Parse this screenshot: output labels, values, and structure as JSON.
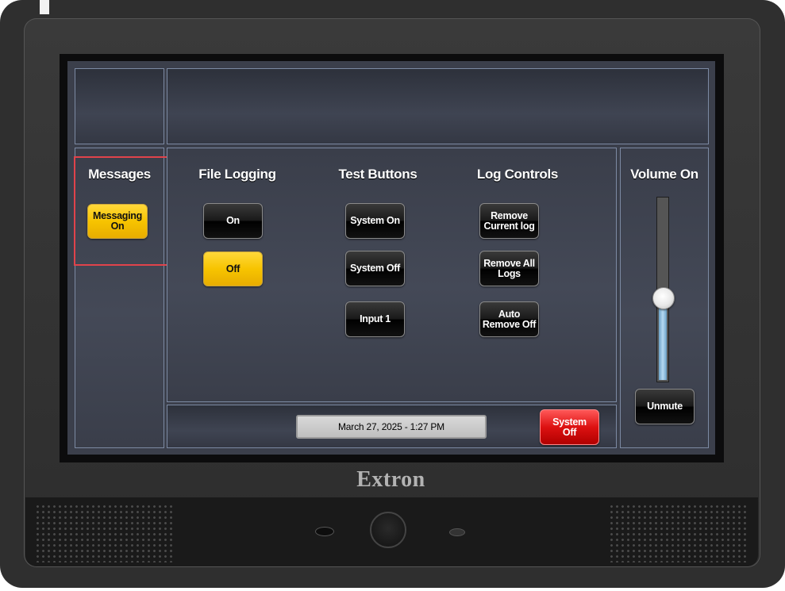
{
  "brand": "Extron",
  "messages": {
    "heading": "Messages",
    "messaging_button": "Messaging\nOn"
  },
  "file_logging": {
    "heading": "File Logging",
    "on_button": "On",
    "off_button": "Off"
  },
  "test_buttons": {
    "heading": "Test Buttons",
    "system_on": "System On",
    "system_off": "System Off",
    "input1": "Input 1"
  },
  "log_controls": {
    "heading": "Log Controls",
    "remove_current": "Remove\nCurrent log",
    "remove_all": "Remove All\nLogs",
    "auto_remove": "Auto\nRemove Off"
  },
  "volume": {
    "heading": "Volume On",
    "level": 0.45,
    "unmute_button": "Unmute"
  },
  "footer": {
    "datetime": "March 27, 2025  -  1:27 PM",
    "system_off_button": "System\nOff"
  },
  "colors": {
    "active_yellow": "#f7c400",
    "alert_red": "#dd1111",
    "panel_border": "#7c8aa3"
  }
}
